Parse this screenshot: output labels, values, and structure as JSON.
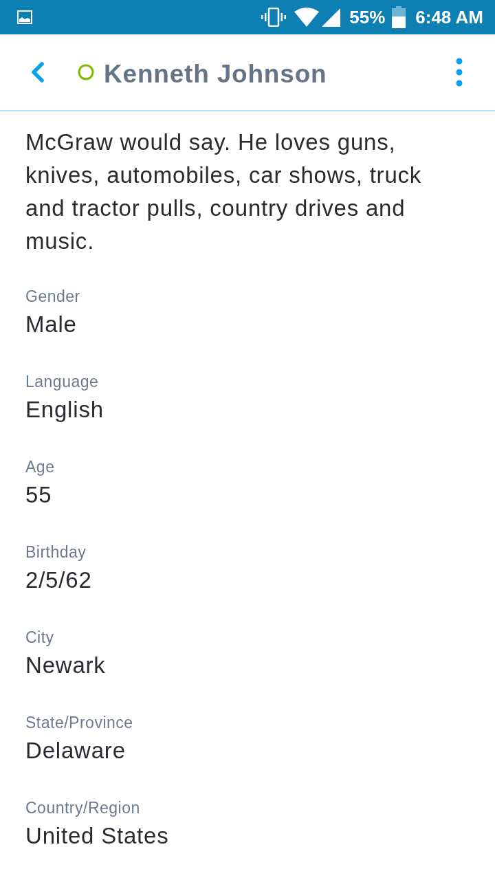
{
  "status_bar": {
    "battery": "55%",
    "time": "6:48 AM"
  },
  "header": {
    "title": "Kenneth Johnson"
  },
  "about": "McGraw would say. He loves guns, knives, automobiles, car shows, truck and tractor pulls, country drives and music.",
  "fields": [
    {
      "label": "Gender",
      "value": "Male"
    },
    {
      "label": "Language",
      "value": "English"
    },
    {
      "label": "Age",
      "value": "55"
    },
    {
      "label": "Birthday",
      "value": "2/5/62"
    },
    {
      "label": "City",
      "value": "Newark"
    },
    {
      "label": "State/Province",
      "value": "Delaware"
    },
    {
      "label": "Country/Region",
      "value": "United States"
    }
  ]
}
